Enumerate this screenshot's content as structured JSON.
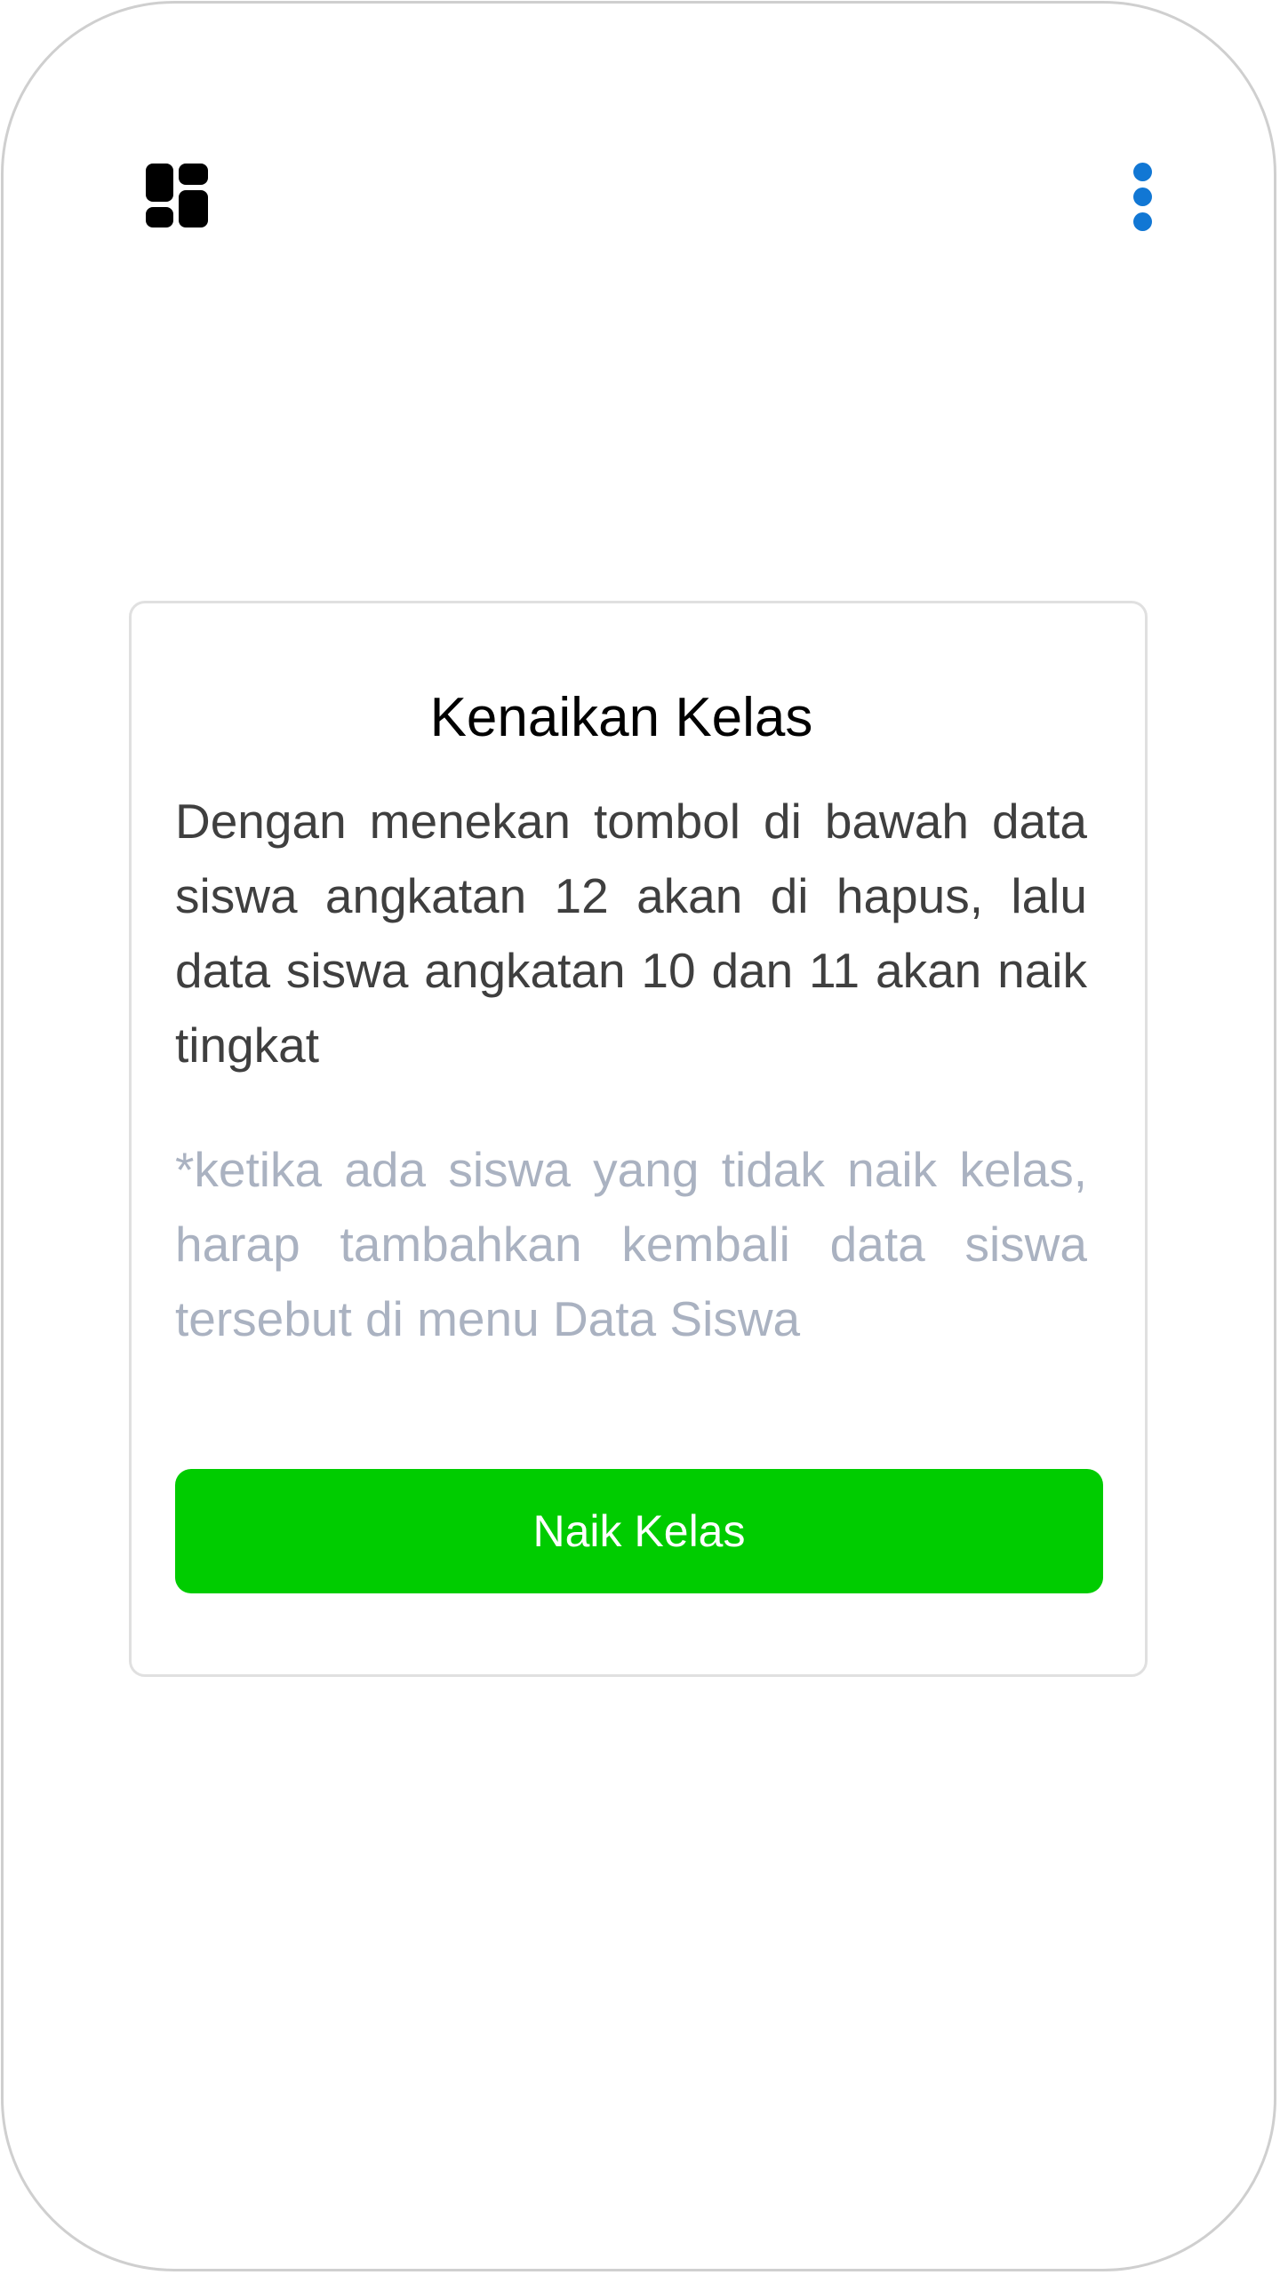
{
  "header": {
    "menu_icon": "dashboard-grid-icon",
    "more_icon": "more-vertical-icon",
    "accent_color": "#1177d4"
  },
  "card": {
    "title": "Kenaikan Kelas",
    "description": "Dengan menekan tombol di bawah data siswa angkatan 12 akan di hapus, lalu data siswa angkatan 10 dan 11 akan naik tingkat",
    "note": "*ketika ada siswa yang tidak naik kelas, harap tambahkan kembali data siswa tersebut di menu Data Siswa",
    "button_label": "Naik Kelas",
    "button_color": "#00cc00"
  }
}
